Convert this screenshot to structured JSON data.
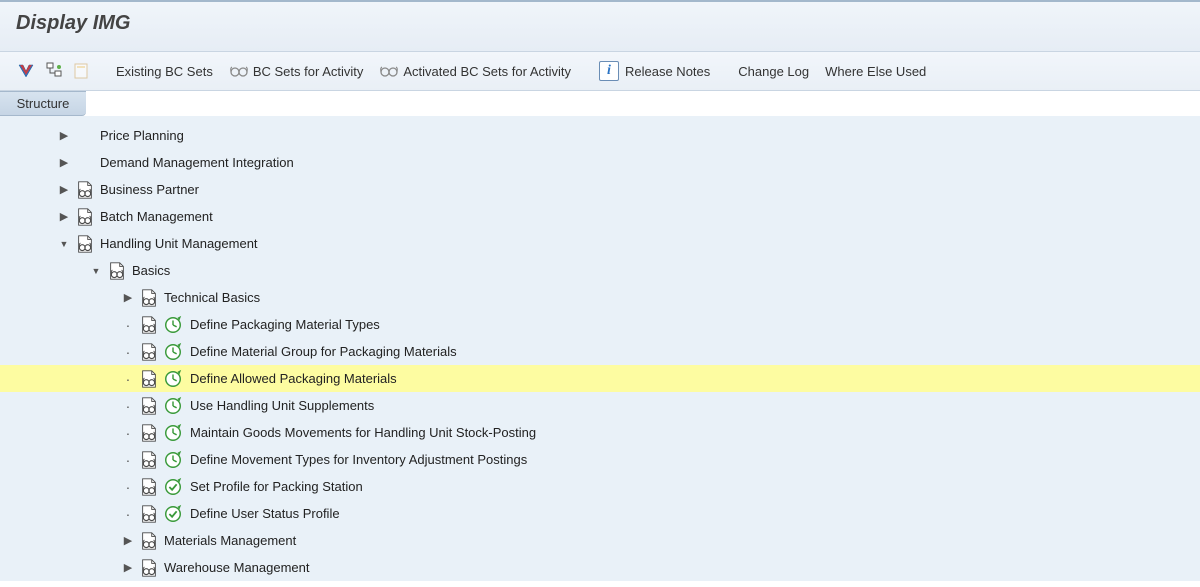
{
  "header": {
    "title": "Display IMG"
  },
  "toolbar": {
    "existing_bc": "Existing BC Sets",
    "bc_for_activity": "BC Sets for Activity",
    "activated_bc": "Activated BC Sets for Activity",
    "release_notes": "Release Notes",
    "change_log": "Change Log",
    "where_else": "Where Else Used"
  },
  "structure_label": "Structure",
  "tree": [
    {
      "level": 0,
      "expander": "collapsed",
      "doc": false,
      "activity": null,
      "label": "Price Planning",
      "hl": false
    },
    {
      "level": 0,
      "expander": "collapsed",
      "doc": false,
      "activity": null,
      "label": "Demand Management Integration",
      "hl": false
    },
    {
      "level": 0,
      "expander": "collapsed",
      "doc": true,
      "activity": null,
      "label": "Business Partner",
      "hl": false
    },
    {
      "level": 0,
      "expander": "collapsed",
      "doc": true,
      "activity": null,
      "label": "Batch Management",
      "hl": false
    },
    {
      "level": 0,
      "expander": "expanded",
      "doc": true,
      "activity": null,
      "label": "Handling Unit Management",
      "hl": false
    },
    {
      "level": 1,
      "expander": "expanded",
      "doc": true,
      "activity": null,
      "label": "Basics",
      "hl": false
    },
    {
      "level": 2,
      "expander": "collapsed",
      "doc": true,
      "activity": null,
      "label": "Technical Basics",
      "hl": false
    },
    {
      "level": 2,
      "expander": "leaf",
      "doc": true,
      "activity": "clock",
      "label": "Define Packaging Material Types",
      "hl": false
    },
    {
      "level": 2,
      "expander": "leaf",
      "doc": true,
      "activity": "clock",
      "label": "Define Material Group for Packaging Materials",
      "hl": false
    },
    {
      "level": 2,
      "expander": "leaf",
      "doc": true,
      "activity": "clock",
      "label": "Define Allowed Packaging Materials",
      "hl": true
    },
    {
      "level": 2,
      "expander": "leaf",
      "doc": true,
      "activity": "clock",
      "label": "Use Handling Unit Supplements",
      "hl": false
    },
    {
      "level": 2,
      "expander": "leaf",
      "doc": true,
      "activity": "clock",
      "label": "Maintain Goods Movements for Handling Unit Stock-Posting",
      "hl": false
    },
    {
      "level": 2,
      "expander": "leaf",
      "doc": true,
      "activity": "clock",
      "label": "Define Movement Types for Inventory Adjustment Postings",
      "hl": false
    },
    {
      "level": 2,
      "expander": "leaf",
      "doc": true,
      "activity": "check",
      "label": "Set Profile for Packing Station",
      "hl": false
    },
    {
      "level": 2,
      "expander": "leaf",
      "doc": true,
      "activity": "check",
      "label": "Define User Status Profile",
      "hl": false
    },
    {
      "level": 2,
      "expander": "collapsed",
      "doc": true,
      "activity": null,
      "label": "Materials Management",
      "hl": false
    },
    {
      "level": 2,
      "expander": "collapsed",
      "doc": true,
      "activity": null,
      "label": "Warehouse Management",
      "hl": false
    }
  ]
}
